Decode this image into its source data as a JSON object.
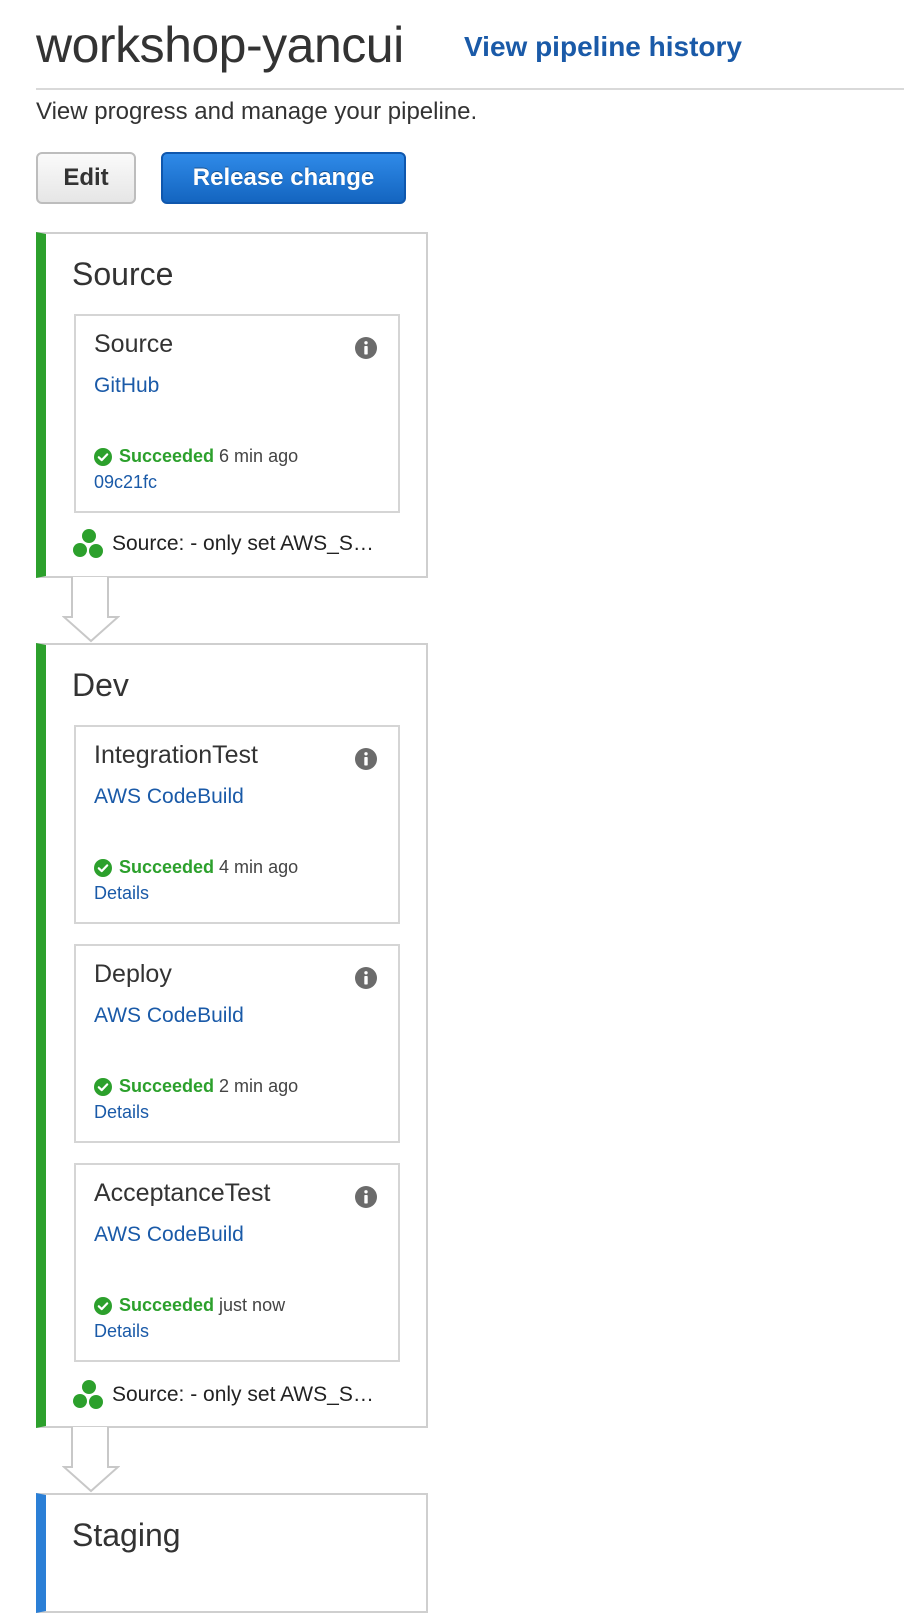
{
  "header": {
    "title": "workshop-yancui",
    "history_link": "View pipeline history"
  },
  "subtitle": "View progress and manage your pipeline.",
  "buttons": {
    "edit": "Edit",
    "release": "Release change"
  },
  "colors": {
    "success_green": "#2ca02c",
    "link_blue": "#1a5aa8",
    "staging_blue": "#2b7fd6"
  },
  "stages": [
    {
      "name": "Source",
      "actions": [
        {
          "name": "Source",
          "provider": "GitHub",
          "status": "Succeeded",
          "time": "6 min ago",
          "link": "09c21fc"
        }
      ],
      "commit": "Source: - only set AWS_S…"
    },
    {
      "name": "Dev",
      "actions": [
        {
          "name": "IntegrationTest",
          "provider": "AWS CodeBuild",
          "status": "Succeeded",
          "time": "4 min ago",
          "link": "Details"
        },
        {
          "name": "Deploy",
          "provider": "AWS CodeBuild",
          "status": "Succeeded",
          "time": "2 min ago",
          "link": "Details"
        },
        {
          "name": "AcceptanceTest",
          "provider": "AWS CodeBuild",
          "status": "Succeeded",
          "time": "just now",
          "link": "Details"
        }
      ],
      "commit": "Source: - only set AWS_S…"
    },
    {
      "name": "Staging"
    }
  ]
}
